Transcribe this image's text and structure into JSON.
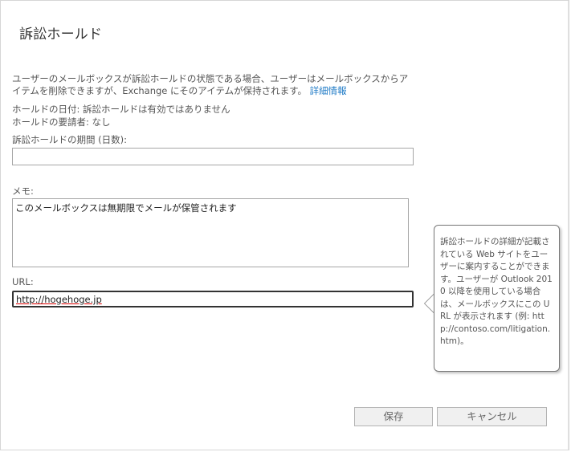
{
  "dialog": {
    "title": "訴訟ホールド",
    "description": "ユーザーのメールボックスが訴訟ホールドの状態である場合、ユーザーはメールボックスからアイテムを削除できますが、Exchange にそのアイテムが保持されます。",
    "details_link": "詳細情報",
    "hold_date": "ホールドの日付: 訴訟ホールドは有効ではありません",
    "hold_requester": "ホールドの要請者: なし",
    "duration_label": "訴訟ホールドの期間 (日数):",
    "duration_value": "",
    "memo_label": "メモ:",
    "memo_value": "このメールボックスは無期限でメールが保管されます",
    "url_label": "URL:",
    "url_value": "http://hogehoge.jp",
    "tooltip": "訴訟ホールドの詳細が記載されている Web サイトをユーザーに案内することができます。ユーザーが Outlook 2010 以降を使用している場合は、メールボックスにこの URL が表示されます (例: http://contoso.com/litigation.htm)。",
    "save_button": "保存",
    "cancel_button": "キャンセル"
  },
  "colors": {
    "link": "#1e7ac6",
    "border": "#a6a6a6",
    "focus_border": "#333333"
  }
}
